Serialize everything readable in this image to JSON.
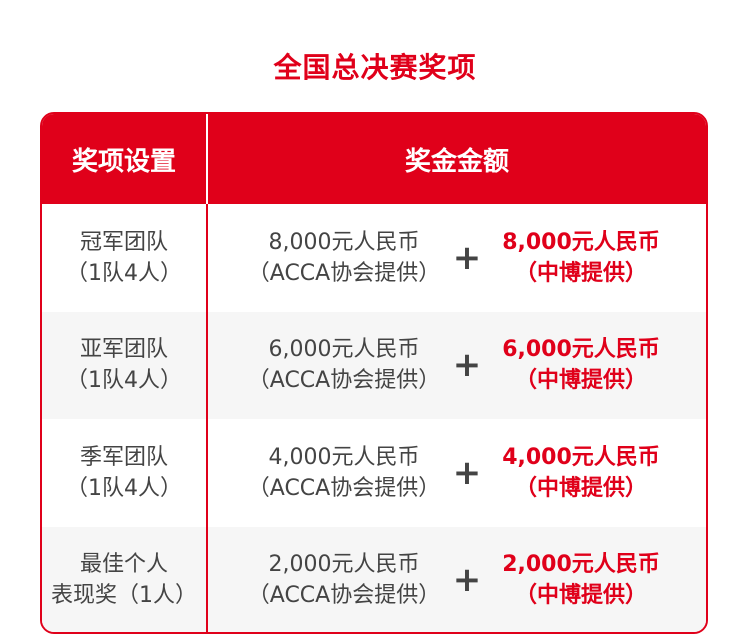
{
  "title": "全国总决赛奖项",
  "header": {
    "col1": "奖项设置",
    "col2": "奖金金额"
  },
  "rows": [
    {
      "award_line1": "冠军团队",
      "award_line2": "（1队4人）",
      "amount_line1": "8,000元人民币",
      "amount_line2": "（ACCA协会提供）",
      "plus": "+",
      "extra_line1": "8,000元人民币",
      "extra_line2": "（中博提供）"
    },
    {
      "award_line1": "亚军团队",
      "award_line2": "（1队4人）",
      "amount_line1": "6,000元人民币",
      "amount_line2": "（ACCA协会提供）",
      "plus": "+",
      "extra_line1": "6,000元人民币",
      "extra_line2": "（中博提供）"
    },
    {
      "award_line1": "季军团队",
      "award_line2": "（1队4人）",
      "amount_line1": "4,000元人民币",
      "amount_line2": "（ACCA协会提供）",
      "plus": "+",
      "extra_line1": "4,000元人民币",
      "extra_line2": "（中博提供）"
    },
    {
      "award_line1": "最佳个人",
      "award_line2": "表现奖（1人）",
      "amount_line1": "2,000元人民币",
      "amount_line2": "（ACCA协会提供）",
      "plus": "+",
      "extra_line1": "2,000元人民币",
      "extra_line2": "（中博提供）"
    }
  ],
  "colors": {
    "accent": "#e0001a",
    "text": "#444444",
    "alt_row": "#f6f6f6"
  }
}
